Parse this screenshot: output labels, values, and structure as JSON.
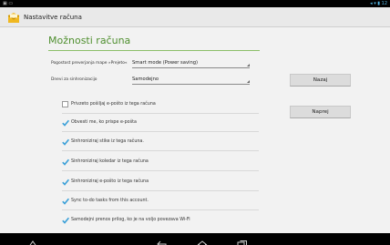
{
  "status_bar": {
    "left_icons": "▣ ▭",
    "right_icons": "◂ ▾ ▮ 12"
  },
  "action_bar": {
    "title": "Nastavitve računa",
    "app_icon": "email-envelope-icon"
  },
  "page": {
    "title": "Možnosti računa"
  },
  "form": {
    "check_frequency_label": "Pogostost preverjanja mape »Prejeto«",
    "check_frequency_value": "Smart mode (Power saving)",
    "sync_days_label": "Dnevi za sinhronizacijo",
    "sync_days_value": "Samodejno"
  },
  "buttons": {
    "back_label": "Nazaj",
    "next_label": "Naprej"
  },
  "options": [
    {
      "label": "Privzeto pošiljaj e-pošto iz tega računa",
      "checked": false
    },
    {
      "label": "Obvesti me, ko prispe e-pošta",
      "checked": true
    },
    {
      "label": "Sinhroniziraj stike iz tega računa.",
      "checked": true
    },
    {
      "label": "Sinhroniziraj koledar iz tega računa",
      "checked": true
    },
    {
      "label": "Sinhroniziraj e-pošto iz tega računa",
      "checked": true
    },
    {
      "label": "Sync to-do tasks from this account.",
      "checked": true
    },
    {
      "label": "Samodejni prenos prilog, ko je na voljo povezava Wi-Fi",
      "checked": true
    }
  ],
  "colors": {
    "accent_green": "#4f8f2f",
    "checkbox_blue": "#3aa0d8",
    "status_icon_blue": "#55b9e6"
  },
  "nav_bar": {
    "icons": [
      "asus-home-icon",
      "back-icon",
      "home-icon",
      "recent-apps-icon"
    ]
  }
}
